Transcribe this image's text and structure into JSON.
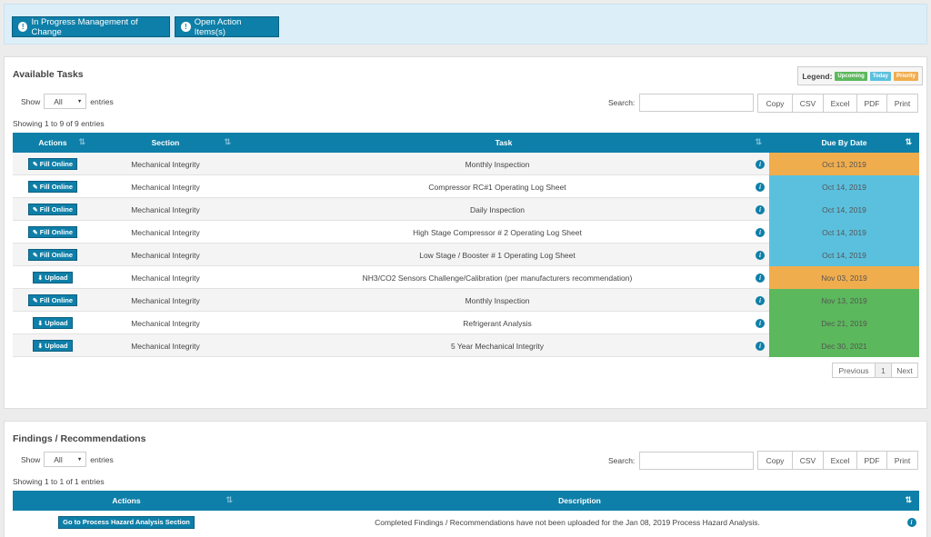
{
  "topbar": {
    "btn_moc": "In Progress Management of Change",
    "btn_actions": "Open Action Items(s)"
  },
  "colors": {
    "upcoming": "#5cb85c",
    "today": "#5bc0de",
    "priority": "#f0ad4e",
    "primary": "#0e7fa8"
  },
  "tasks": {
    "title": "Available Tasks",
    "legend": {
      "label": "Legend:",
      "upcoming": "Upcoming",
      "today": "Today",
      "priority": "Priority"
    },
    "show_label": "Show",
    "show_value": "All",
    "entries_label": "entries",
    "search_label": "Search:",
    "exports": [
      "Copy",
      "CSV",
      "Excel",
      "PDF",
      "Print"
    ],
    "info": "Showing 1 to 9 of 9 entries",
    "columns": [
      "Actions",
      "Section",
      "Task",
      "Due By Date"
    ],
    "rows": [
      {
        "action": "Fill Online",
        "action_type": "edit",
        "section": "Mechanical Integrity",
        "task": "Monthly Inspection",
        "due": "Oct 13, 2019",
        "status": "priority"
      },
      {
        "action": "Fill Online",
        "action_type": "edit",
        "section": "Mechanical Integrity",
        "task": "Compressor RC#1 Operating Log Sheet",
        "due": "Oct 14, 2019",
        "status": "today"
      },
      {
        "action": "Fill Online",
        "action_type": "edit",
        "section": "Mechanical Integrity",
        "task": "Daily Inspection",
        "due": "Oct 14, 2019",
        "status": "today"
      },
      {
        "action": "Fill Online",
        "action_type": "edit",
        "section": "Mechanical Integrity",
        "task": "High Stage Compressor # 2 Operating Log Sheet",
        "due": "Oct 14, 2019",
        "status": "today"
      },
      {
        "action": "Fill Online",
        "action_type": "edit",
        "section": "Mechanical Integrity",
        "task": "Low Stage / Booster # 1 Operating Log Sheet",
        "due": "Oct 14, 2019",
        "status": "today"
      },
      {
        "action": "Upload",
        "action_type": "upload",
        "section": "Mechanical Integrity",
        "task": "NH3/CO2 Sensors Challenge/Calibration (per manufacturers recommendation)",
        "due": "Nov 03, 2019",
        "status": "priority"
      },
      {
        "action": "Fill Online",
        "action_type": "edit",
        "section": "Mechanical Integrity",
        "task": "Monthly Inspection",
        "due": "Nov 13, 2019",
        "status": "upcoming"
      },
      {
        "action": "Upload",
        "action_type": "upload",
        "section": "Mechanical Integrity",
        "task": "Refrigerant Analysis",
        "due": "Dec 21, 2019",
        "status": "upcoming"
      },
      {
        "action": "Upload",
        "action_type": "upload",
        "section": "Mechanical Integrity",
        "task": "5 Year Mechanical Integrity",
        "due": "Dec 30, 2021",
        "status": "upcoming"
      }
    ],
    "pager": {
      "prev": "Previous",
      "page": "1",
      "next": "Next"
    }
  },
  "findings": {
    "title": "Findings / Recommendations",
    "show_label": "Show",
    "show_value": "All",
    "entries_label": "entries",
    "search_label": "Search:",
    "exports": [
      "Copy",
      "CSV",
      "Excel",
      "PDF",
      "Print"
    ],
    "info": "Showing 1 to 1 of 1 entries",
    "columns": [
      "Actions",
      "Description"
    ],
    "rows": [
      {
        "action": "Go to Process Hazard Analysis Section",
        "description": "Completed Findings / Recommendations have not been uploaded for the Jan 08, 2019 Process Hazard Analysis."
      }
    ]
  }
}
